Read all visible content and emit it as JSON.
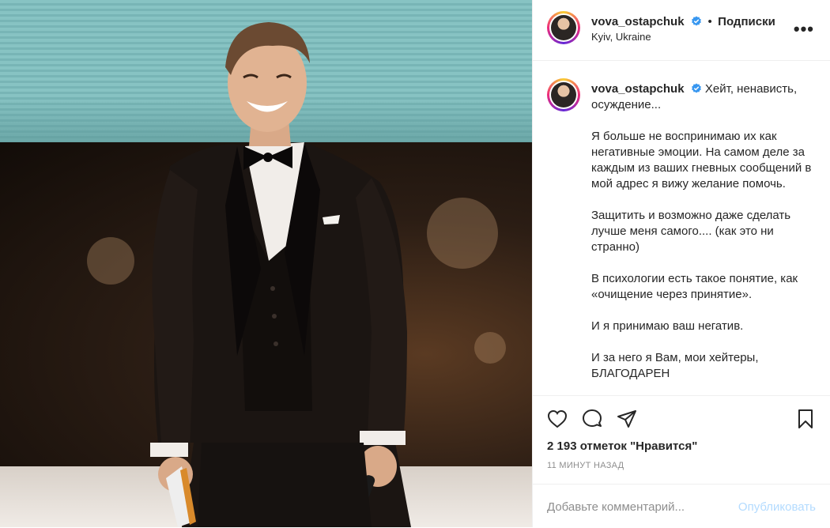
{
  "post": {
    "username": "vova_ostapchuk",
    "follow_separator": "•",
    "follow_label": "Подписки",
    "location": "Kyiv, Ukraine",
    "more_icon": "more-horizontal-icon",
    "caption": {
      "username": "vova_ostapchuk",
      "lines": [
        "Хейт, ненависть, осуждение...",
        "Я больше не воспринимаю их как негативные эмоции. На самом деле за каждым из ваших гневных сообщений в мой адрес я вижу желание помочь.",
        "Защитить и возможно даже сделать лучше меня самого.... (как это ни странно)",
        "В психологии есть такое понятие, как «очищение через принятие».",
        "И я принимаю ваш негатив.",
        "И за него я Вам, мои хейтеры, БЛАГОДАРЕН"
      ]
    },
    "actions": {
      "like_icon": "heart-icon",
      "comment_icon": "comment-icon",
      "share_icon": "send-icon",
      "save_icon": "bookmark-icon"
    },
    "likes_text": "2 193 отметок \"Нравится\"",
    "time_text": "11 МИНУТ НАЗАД",
    "comment_placeholder": "Добавьте комментарий...",
    "publish_label": "Опубликовать"
  },
  "colors": {
    "verified": "#3897f0",
    "publish_disabled": "#b3dbff",
    "muted": "#8e8e8e"
  }
}
